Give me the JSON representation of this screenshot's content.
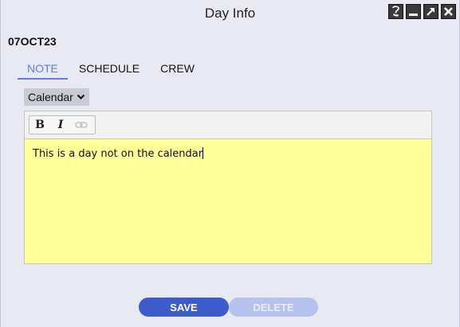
{
  "window": {
    "title": "Day Info",
    "controls": [
      "help-icon",
      "minimize-icon",
      "maximize-icon",
      "close-icon"
    ]
  },
  "day": {
    "label": "07OCT23"
  },
  "tabs": [
    {
      "label": "NOTE",
      "active": true
    },
    {
      "label": "SCHEDULE",
      "active": false
    },
    {
      "label": "CREW",
      "active": false
    }
  ],
  "note_type": {
    "selected": "Calendar"
  },
  "editor": {
    "toolbar": {
      "bold": "B",
      "italic": "I"
    },
    "content": "This is a day not on the calendar",
    "background": "#ffff99"
  },
  "actions": {
    "save_label": "SAVE",
    "delete_label": "DELETE",
    "save_color": "#3e5bcc",
    "delete_color": "#b6c2ee"
  }
}
